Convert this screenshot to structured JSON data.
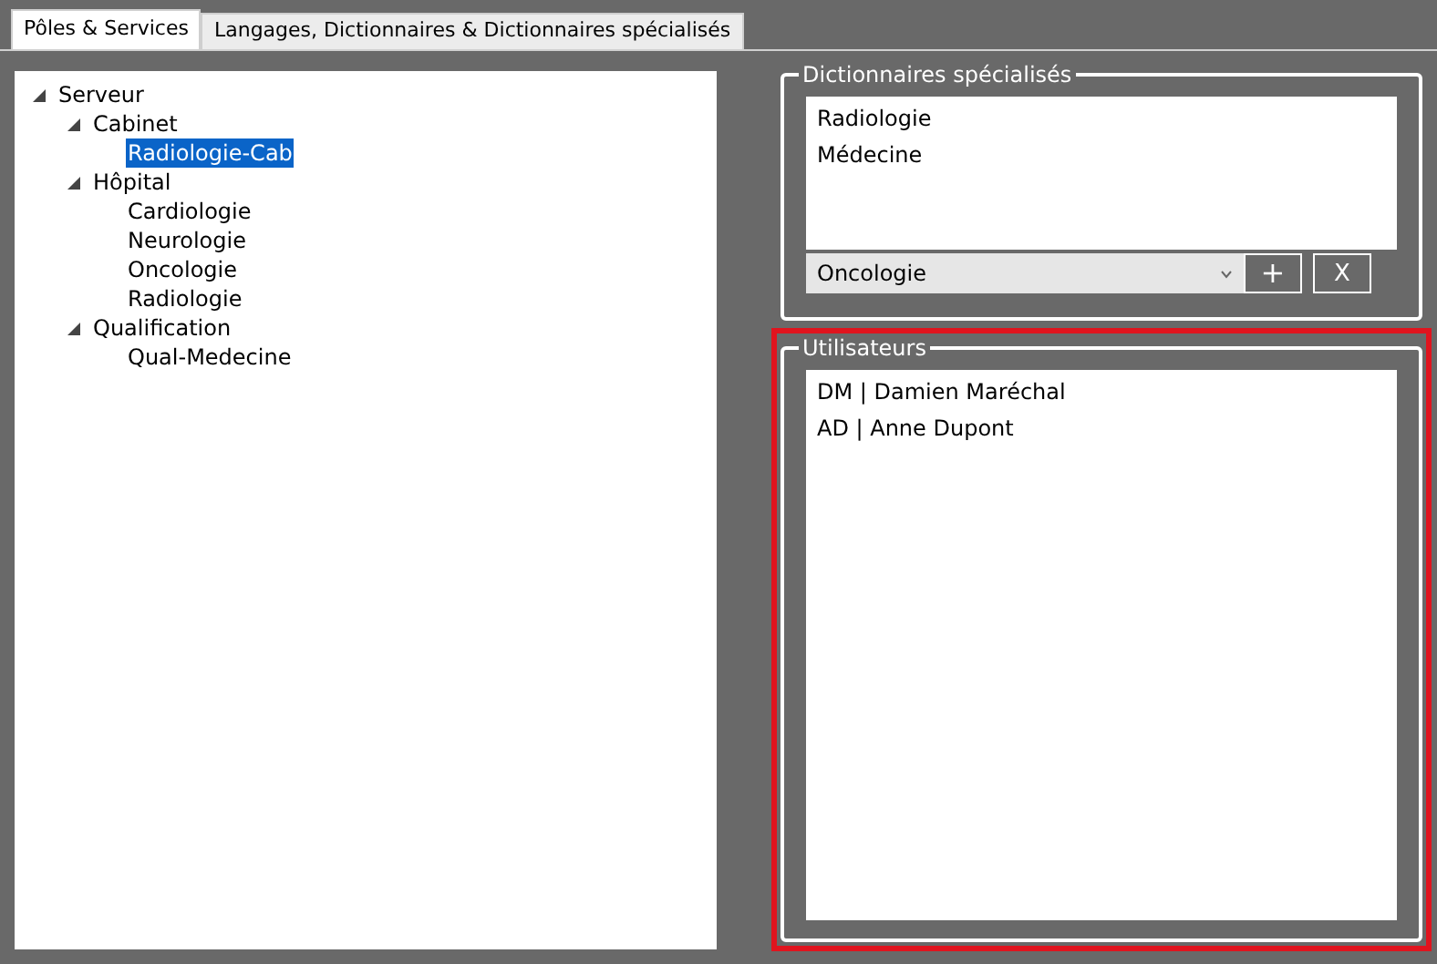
{
  "tabs": [
    {
      "label": "Pôles & Services",
      "selected": true
    },
    {
      "label": "Langages, Dictionnaires & Dictionnaires spécialisés",
      "selected": false
    }
  ],
  "tree": [
    {
      "label": "Serveur",
      "expanded": true,
      "selected": false,
      "children": [
        {
          "label": "Cabinet",
          "expanded": true,
          "selected": false,
          "children": [
            {
              "label": "Radiologie-Cab",
              "selected": true
            }
          ]
        },
        {
          "label": "Hôpital",
          "expanded": true,
          "selected": false,
          "children": [
            {
              "label": "Cardiologie",
              "selected": false
            },
            {
              "label": "Neurologie",
              "selected": false
            },
            {
              "label": "Oncologie",
              "selected": false
            },
            {
              "label": "Radiologie",
              "selected": false
            }
          ]
        },
        {
          "label": "Qualification",
          "expanded": true,
          "selected": false,
          "children": [
            {
              "label": "Qual-Medecine",
              "selected": false
            }
          ]
        }
      ]
    }
  ],
  "dictionaries": {
    "title": "Dictionnaires spécialisés",
    "items": [
      "Radiologie",
      "Médecine"
    ],
    "dropdown_value": "Oncologie",
    "add_button": "+",
    "remove_button": "X"
  },
  "users": {
    "title": "Utilisateurs",
    "highlighted": true,
    "items": [
      "DM | Damien Maréchal",
      "AD | Anne Dupont"
    ]
  }
}
